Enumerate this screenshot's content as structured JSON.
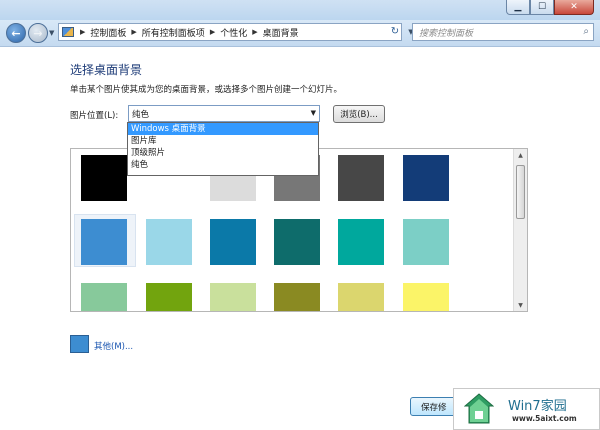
{
  "breadcrumbs": [
    "控制面板",
    "所有控制面板项",
    "个性化",
    "桌面背景"
  ],
  "search": {
    "placeholder": "搜索控制面板"
  },
  "page": {
    "title": "选择桌面背景",
    "description": "单击某个图片使其成为您的桌面背景，或选择多个图片创建一个幻灯片。",
    "location_label": "图片位置(L):",
    "location_value": "纯色",
    "browse_label": "浏览(B)..."
  },
  "dropdown": {
    "options": [
      "Windows 桌面背景",
      "图片库",
      "顶级照片",
      "纯色"
    ],
    "highlighted": "Windows 桌面背景"
  },
  "swatches": {
    "row1": [
      "#000000",
      "#ffffff",
      "#dcdcdc",
      "#777777",
      "#474747",
      "#133c78"
    ],
    "row2": [
      "#3d8dd1",
      "#9ad7e8",
      "#0b79a8",
      "#0e6c6b",
      "#00a89d",
      "#7ccfc6"
    ],
    "row3": [
      "#87c99b",
      "#72a40e",
      "#c9e09c",
      "#8a8a22",
      "#dbd66e",
      "#fbf468"
    ],
    "selected": "#3d8dd1"
  },
  "other": {
    "label": "其他(M)...",
    "color": "#3d8dd1"
  },
  "save_label": "保存修",
  "watermark": {
    "title": "Win7家园",
    "url": "www.5aixt.com"
  }
}
